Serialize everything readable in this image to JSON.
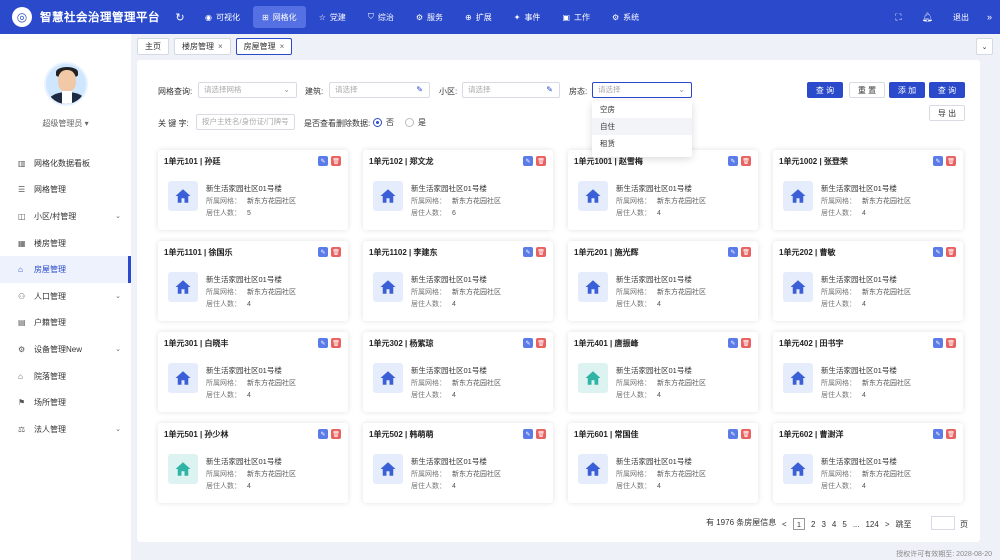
{
  "header": {
    "title": "智慧社会治理管理平台",
    "nav": [
      {
        "label": "可视化",
        "icon": "eye-icon"
      },
      {
        "label": "网格化",
        "icon": "grid-icon",
        "active": true
      },
      {
        "label": "党建",
        "icon": "star-icon"
      },
      {
        "label": "综治",
        "icon": "shield-icon"
      },
      {
        "label": "服务",
        "icon": "service-icon"
      },
      {
        "label": "扩展",
        "icon": "extend-icon"
      },
      {
        "label": "事件",
        "icon": "event-icon"
      },
      {
        "label": "工作",
        "icon": "work-icon"
      },
      {
        "label": "系统",
        "icon": "gear-icon"
      }
    ],
    "logout": "退出"
  },
  "sidebar": {
    "username": "超级管理员",
    "items": [
      {
        "label": "网格化数据看板",
        "icon": "chart-icon"
      },
      {
        "label": "网格管理",
        "icon": "list-icon"
      },
      {
        "label": "小区/村管理",
        "icon": "community-icon",
        "arrow": true
      },
      {
        "label": "楼房管理",
        "icon": "building-icon"
      },
      {
        "label": "房屋管理",
        "icon": "house-icon",
        "active": true
      },
      {
        "label": "人口管理",
        "icon": "people-icon",
        "arrow": true
      },
      {
        "label": "户籍管理",
        "icon": "book-icon"
      },
      {
        "label": "设备管理New",
        "icon": "device-icon",
        "arrow": true
      },
      {
        "label": "院落管理",
        "icon": "yard-icon"
      },
      {
        "label": "场所管理",
        "icon": "place-icon"
      },
      {
        "label": "法人管理",
        "icon": "legal-icon",
        "arrow": true
      }
    ]
  },
  "tabs": [
    {
      "label": "主页",
      "closable": false
    },
    {
      "label": "楼房管理",
      "closable": true
    },
    {
      "label": "房屋管理",
      "closable": true,
      "active": true
    }
  ],
  "filters": {
    "grid_label": "网格查询:",
    "grid_placeholder": "请选择网格",
    "building_label": "建筑:",
    "building_placeholder": "请选择",
    "community_label": "小区:",
    "community_placeholder": "请选择",
    "state_label": "房态:",
    "state_placeholder": "请选择",
    "keyword_label": "关 键 字:",
    "keyword_placeholder": "按户主姓名/身份证/门牌号",
    "deleted_label": "是否查看删除数据:",
    "option_no": "否",
    "option_yes": "是",
    "state_options": [
      "空房",
      "自住",
      "租赁"
    ]
  },
  "buttons": {
    "search": "查 询",
    "reset": "重 置",
    "add": "添 加",
    "query": "查 询",
    "export": "导 出"
  },
  "card_common": {
    "address": "新生活家园社区01号楼",
    "grid_label": "所属网格：",
    "grid_value": "新东方花园社区",
    "residents_label": "居住人数："
  },
  "cards": [
    {
      "title": "1单元101 | 孙廷",
      "residents": "5",
      "teal": false
    },
    {
      "title": "1单元102 | 郑文龙",
      "residents": "6",
      "teal": false
    },
    {
      "title": "1单元1001 | 赵雪梅",
      "residents": "4",
      "teal": false
    },
    {
      "title": "1单元1002 | 张登荣",
      "residents": "4",
      "teal": false
    },
    {
      "title": "1单元1101 | 徐国乐",
      "residents": "4",
      "teal": false
    },
    {
      "title": "1单元1102 | 李建东",
      "residents": "4",
      "teal": false
    },
    {
      "title": "1单元201 | 施光辉",
      "residents": "4",
      "teal": false
    },
    {
      "title": "1单元202 | 曹敏",
      "residents": "4",
      "teal": false
    },
    {
      "title": "1单元301 | 白晓丰",
      "residents": "4",
      "teal": false
    },
    {
      "title": "1单元302 | 杨紫琼",
      "residents": "4",
      "teal": false
    },
    {
      "title": "1单元401 | 唐振峰",
      "residents": "4",
      "teal": true
    },
    {
      "title": "1单元402 | 田书宇",
      "residents": "4",
      "teal": false
    },
    {
      "title": "1单元501 | 孙少林",
      "residents": "4",
      "teal": true
    },
    {
      "title": "1单元502 | 韩萌萌",
      "residents": "4",
      "teal": false
    },
    {
      "title": "1单元601 | 常国佳",
      "residents": "4",
      "teal": false
    },
    {
      "title": "1单元602 | 曹澍洋",
      "residents": "4",
      "teal": false
    }
  ],
  "pagination": {
    "total_text": "有 1976 条房屋信息",
    "pages": [
      "1",
      "2",
      "3",
      "4",
      "5",
      "...",
      "124"
    ],
    "next": ">",
    "jump_label": "跳至",
    "page_unit": "页"
  },
  "footer": "授权许可有效期至: 2028-08-20"
}
